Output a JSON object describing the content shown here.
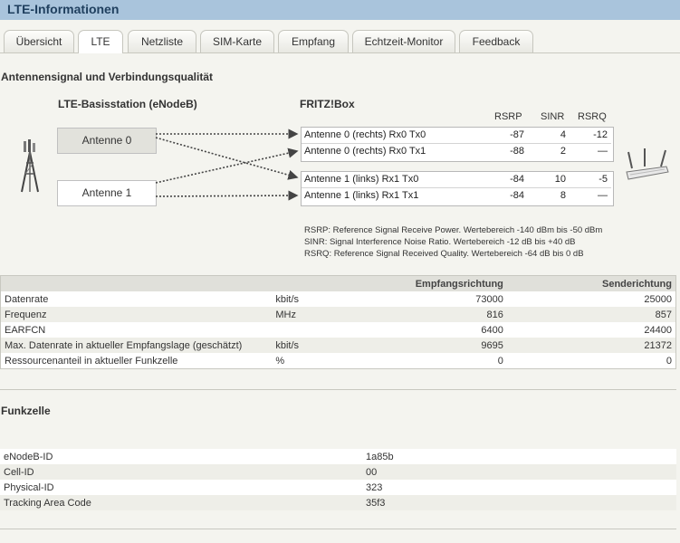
{
  "header": {
    "title": "LTE-Informationen"
  },
  "tabs": [
    {
      "label": "Übersicht"
    },
    {
      "label": "LTE",
      "active": true
    },
    {
      "label": "Netzliste"
    },
    {
      "label": "SIM-Karte"
    },
    {
      "label": "Empfang"
    },
    {
      "label": "Echtzeit-Monitor"
    },
    {
      "label": "Feedback"
    }
  ],
  "signal": {
    "title": "Antennensignal und Verbindungsqualität",
    "base_station_label": "LTE-Basisstation (eNodeB)",
    "fritzbox_label": "FRITZ!Box",
    "columns": [
      "RSRP",
      "SINR",
      "RSRQ"
    ],
    "base_antennas": [
      "Antenne 0",
      "Antenne 1"
    ],
    "rows": [
      {
        "name": "Antenne 0 (rechts) Rx0 Tx0",
        "rsrp": "-87",
        "sinr": "4",
        "rsrq": "-12"
      },
      {
        "name": "Antenne 0 (rechts) Rx0 Tx1",
        "rsrp": "-88",
        "sinr": "2",
        "rsrq": "—"
      },
      {
        "name": "Antenne 1 (links) Rx1 Tx0",
        "rsrp": "-84",
        "sinr": "10",
        "rsrq": "-5"
      },
      {
        "name": "Antenne 1 (links) Rx1 Tx1",
        "rsrp": "-84",
        "sinr": "8",
        "rsrq": "—"
      }
    ],
    "legend": [
      "RSRP: Reference Signal Receive Power. Wertebereich -140 dBm bis -50 dBm",
      "SINR: Signal Interference Noise Ratio. Wertebereich -12 dB bis +40 dB",
      "RSRQ: Reference Signal Received Quality. Wertebereich -64 dB bis 0 dB"
    ]
  },
  "datatable": {
    "headers": [
      "",
      "",
      "Empfangsrichtung",
      "Senderichtung"
    ],
    "rows": [
      {
        "label": "Datenrate",
        "unit": "kbit/s",
        "rx": "73000",
        "tx": "25000"
      },
      {
        "label": "Frequenz",
        "unit": "MHz",
        "rx": "816",
        "tx": "857"
      },
      {
        "label": "EARFCN",
        "unit": "",
        "rx": "6400",
        "tx": "24400"
      },
      {
        "label": "Max. Datenrate in aktueller Empfangslage (geschätzt)",
        "unit": "kbit/s",
        "rx": "9695",
        "tx": "21372"
      },
      {
        "label": "Ressourcenanteil in aktueller Funkzelle",
        "unit": "%",
        "rx": "0",
        "tx": "0"
      }
    ]
  },
  "funkzelle": {
    "title": "Funkzelle",
    "rows": [
      {
        "label": "eNodeB-ID",
        "value": "1a85b"
      },
      {
        "label": "Cell-ID",
        "value": "00"
      },
      {
        "label": "Physical-ID",
        "value": "323"
      },
      {
        "label": "Tracking Area Code",
        "value": "35f3"
      }
    ]
  },
  "colors": {
    "titlebar": "#a9c4dc",
    "background": "#f4f4ef"
  }
}
